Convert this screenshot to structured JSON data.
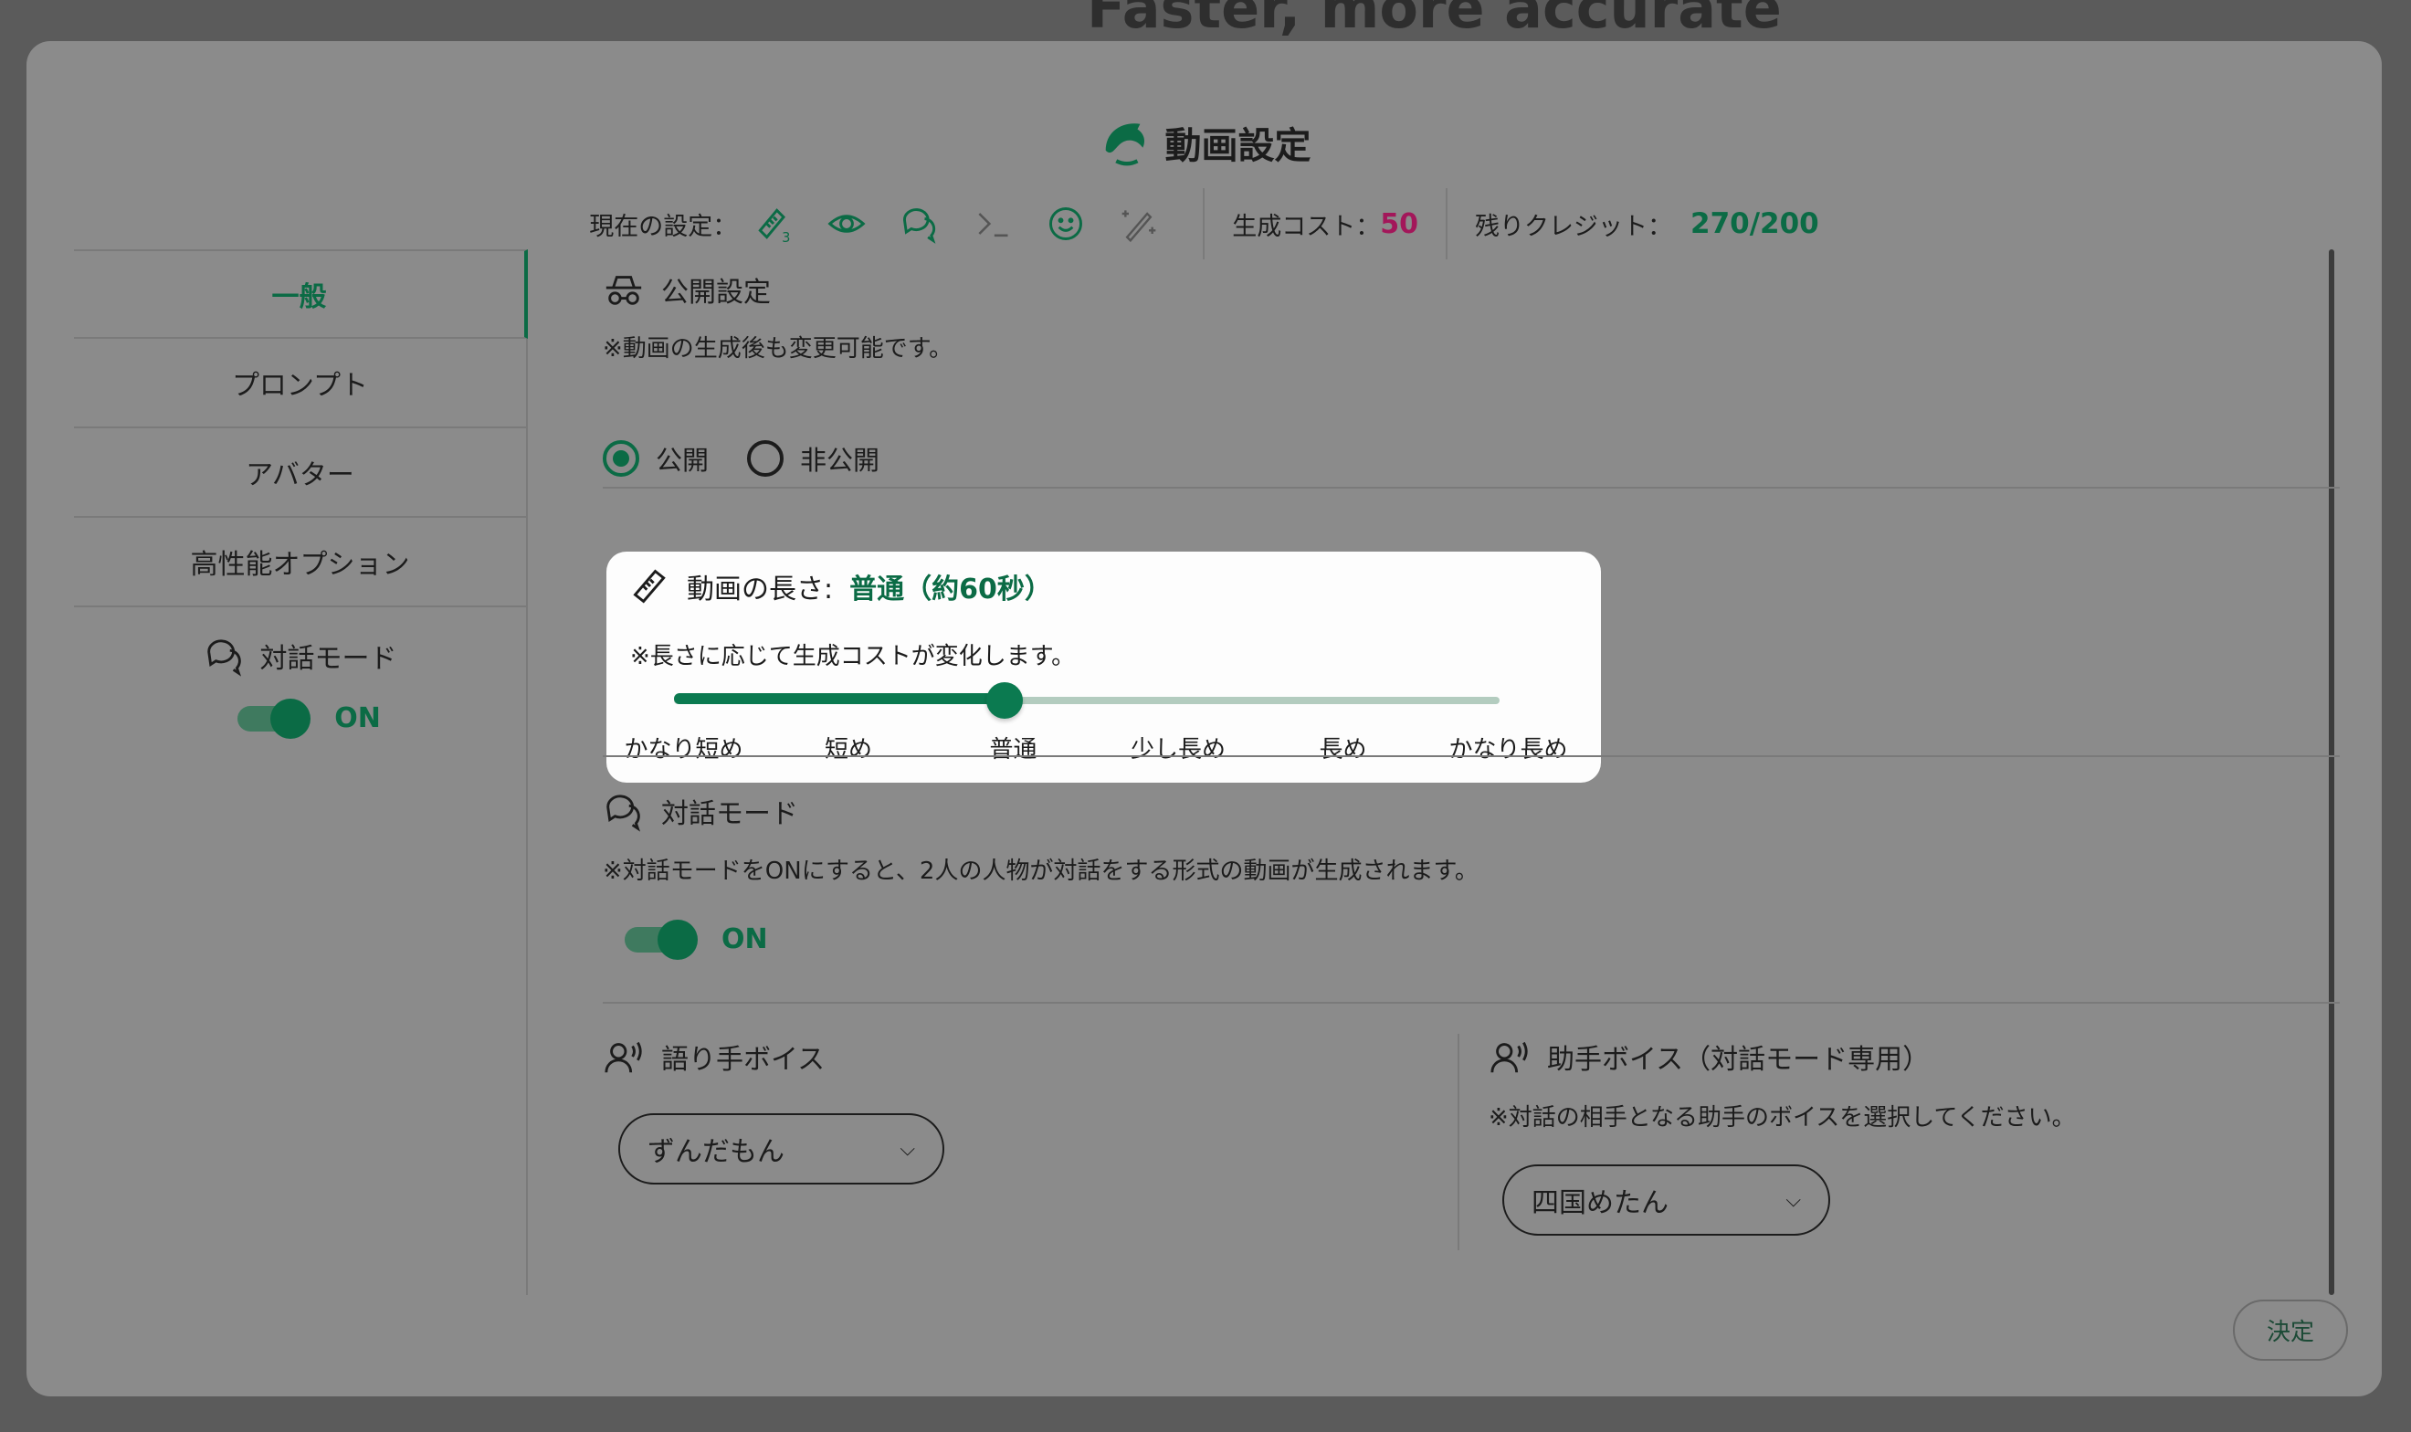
{
  "background": {
    "headline": "Faster, more accurate"
  },
  "header": {
    "title": "動画設定",
    "current_label": "現在の設定：",
    "current_icons": [
      "ruler-3-icon",
      "eye-icon",
      "chat-icon",
      "terminal-icon",
      "smile-icon",
      "magic-wand-icon"
    ],
    "ruler_badge": "3",
    "cost_label": "生成コスト：",
    "cost_value": "50",
    "credit_label": "残りクレジット：",
    "credit_value": "270/200"
  },
  "sidebar": {
    "items": [
      {
        "label": "一般",
        "active": true
      },
      {
        "label": "プロンプト"
      },
      {
        "label": "アバター"
      },
      {
        "label": "高性能オプション"
      }
    ],
    "dialog_label": "対話モード",
    "dialog_toggle": "ON"
  },
  "public": {
    "title": "公開設定",
    "note": "※動画の生成後も変更可能です。",
    "options": [
      "公開",
      "非公開"
    ],
    "selected": "公開"
  },
  "length": {
    "title": "動画の長さ:",
    "value": "普通（約60秒）",
    "note": "※長さに応じて生成コストが変化します。",
    "options": [
      "かなり短め",
      "短め",
      "普通",
      "少し長め",
      "長め",
      "かなり長め"
    ],
    "selected_index": 2
  },
  "dialog": {
    "title": "対話モード",
    "note": "※対話モードをONにすると、2人の人物が対話をする形式の動画が生成されます。",
    "toggle": "ON"
  },
  "narrator": {
    "title": "語り手ボイス",
    "value": "ずんだもん"
  },
  "assistant": {
    "title": "助手ボイス（対話モード専用）",
    "note": "※対話の相手となる助手のボイスを選択してください。",
    "value": "四国めたん"
  },
  "footer": {
    "confirm": "決定"
  },
  "colors": {
    "accent": "#0b7a50",
    "cost": "#a3175a"
  }
}
